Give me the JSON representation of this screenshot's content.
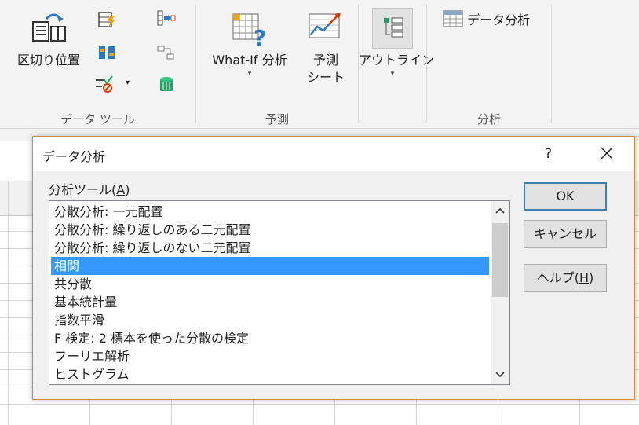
{
  "ribbon": {
    "data_tools": {
      "text_to_columns_label": "区切り位置",
      "group_label": "データ ツール"
    },
    "forecast": {
      "whatif_label": "What-If 分析",
      "forecast_sheet_label_1": "予測",
      "forecast_sheet_label_2": "シート",
      "group_label": "予測"
    },
    "outline": {
      "outline_label": "アウトライン"
    },
    "analysis": {
      "data_analysis_label": "データ分析",
      "group_label": "分析"
    },
    "caret": "▾"
  },
  "dialog": {
    "title": "データ分析",
    "help_symbol": "?",
    "tools_label_prefix": "分析ツール(",
    "tools_label_key": "A",
    "tools_label_suffix": ")",
    "list_items": [
      "分散分析: 一元配置",
      "分散分析: 繰り返しのある二元配置",
      "分散分析: 繰り返しのない二元配置",
      "相関",
      "共分散",
      "基本統計量",
      "指数平滑",
      "F 検定: 2 標本を使った分散の検定",
      "フーリエ解析",
      "ヒストグラム"
    ],
    "selected_index": 3,
    "ok_label": "OK",
    "cancel_label": "キャンセル",
    "help_prefix": "ヘルプ(",
    "help_key": "H",
    "help_suffix": ")"
  },
  "colors": {
    "selection": "#3399ff",
    "dialog_border": "#d08b3a",
    "default_button_border": "#3c7fb1"
  }
}
